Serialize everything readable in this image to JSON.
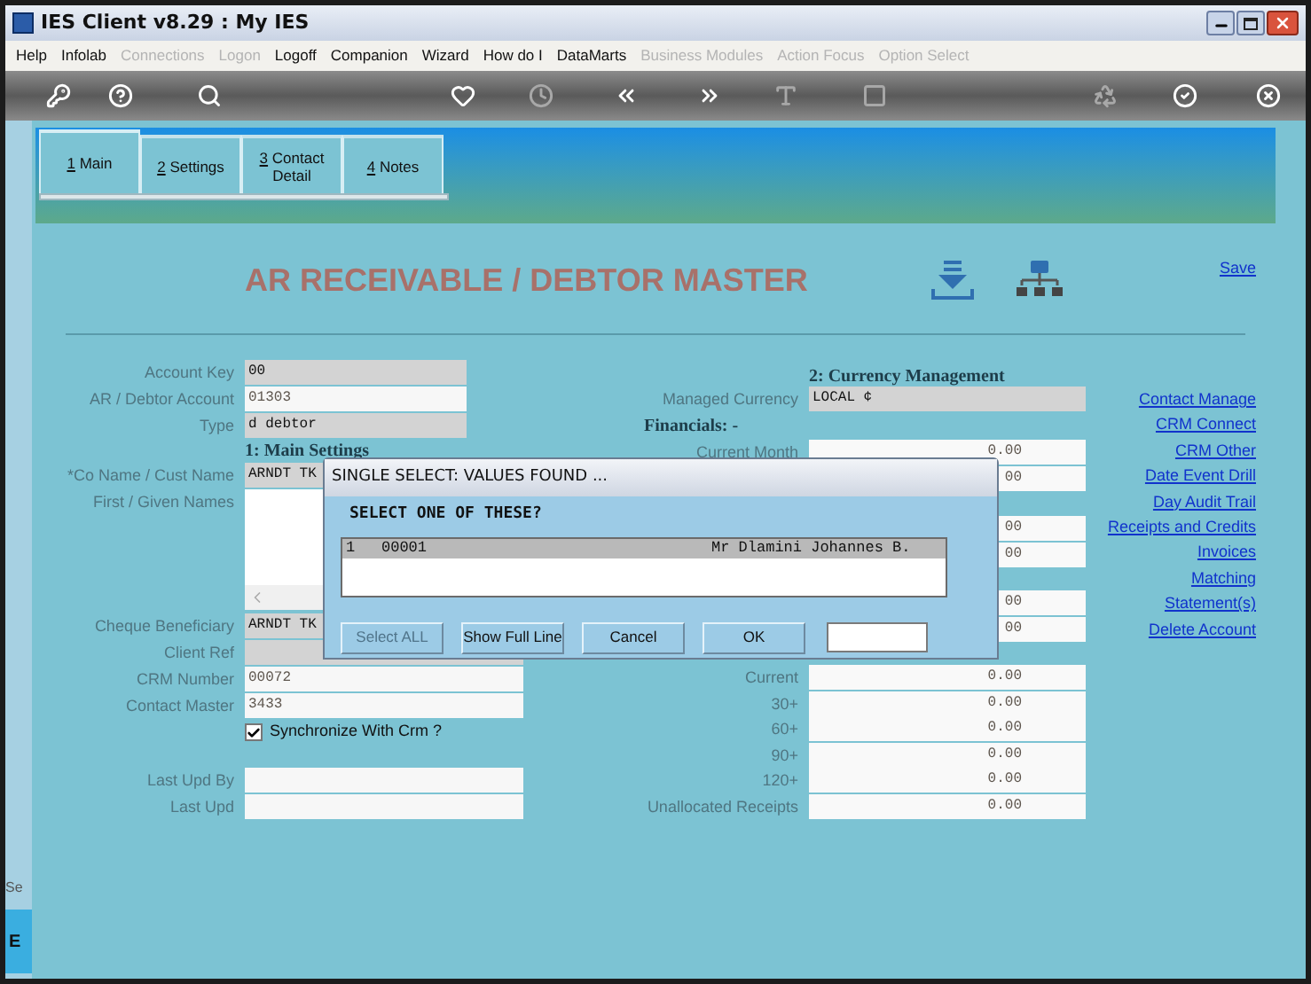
{
  "window": {
    "title": "IES Client v8.29 : My IES"
  },
  "menu": [
    {
      "label": "Help",
      "disabled": false
    },
    {
      "label": "Infolab",
      "disabled": false
    },
    {
      "label": "Connections",
      "disabled": true
    },
    {
      "label": "Logon",
      "disabled": true
    },
    {
      "label": "Logoff",
      "disabled": false
    },
    {
      "label": "Companion",
      "disabled": false
    },
    {
      "label": "Wizard",
      "disabled": false
    },
    {
      "label": "How do I",
      "disabled": false
    },
    {
      "label": "DataMarts",
      "disabled": false
    },
    {
      "label": "Business Modules",
      "disabled": true
    },
    {
      "label": "Action Focus",
      "disabled": true
    },
    {
      "label": "Option Select",
      "disabled": true
    }
  ],
  "toolbar": [
    {
      "kind": "key",
      "disabled": false
    },
    {
      "kind": "help",
      "disabled": false
    },
    {
      "kind": "search",
      "disabled": false
    },
    {
      "kind": "heart",
      "disabled": false
    },
    {
      "kind": "clock",
      "disabled": true
    },
    {
      "kind": "back",
      "disabled": false
    },
    {
      "kind": "forward",
      "disabled": false
    },
    {
      "kind": "text",
      "disabled": true
    },
    {
      "kind": "stop",
      "disabled": true
    },
    {
      "kind": "recycle",
      "disabled": true
    },
    {
      "kind": "check",
      "disabled": false
    },
    {
      "kind": "close",
      "disabled": false
    }
  ],
  "tabs": [
    {
      "mnemonic": "1",
      "label": " Main",
      "selected": true
    },
    {
      "mnemonic": "2",
      "label": " Settings",
      "selected": false
    },
    {
      "mnemonic": "3",
      "label": " Contact Detail",
      "selected": false
    },
    {
      "mnemonic": "4",
      "label": " Notes",
      "selected": false
    }
  ],
  "header": {
    "title": "AR RECEIVABLE / DEBTOR MASTER",
    "save": "Save"
  },
  "left_sections": [
    [
      {
        "kind": "field",
        "label": "Account Key",
        "value": "00",
        "shaded": true
      },
      {
        "kind": "field",
        "label": "AR / Debtor Account",
        "value": "01303",
        "shaded": false
      },
      {
        "kind": "field",
        "label": "Type",
        "value": "d debtor",
        "shaded": true
      },
      {
        "kind": "heading",
        "label": "1: Main Settings"
      },
      {
        "kind": "field",
        "label": "*Co Name / Cust Name",
        "value": "ARNDT TK",
        "shaded": true
      },
      {
        "kind": "memo",
        "label": "First / Given Names"
      }
    ],
    [
      {
        "kind": "field",
        "label": "Cheque Beneficiary",
        "value": "ARNDT TK",
        "shaded": true
      },
      {
        "kind": "field",
        "label": "Client Ref",
        "shaded": true
      },
      {
        "kind": "field",
        "label": "CRM Number",
        "value": "00072",
        "shaded": false
      },
      {
        "kind": "field",
        "label": "Contact Master",
        "value": "3433",
        "shaded": false
      },
      {
        "kind": "checkbox",
        "label": "Synchronize With Crm ?",
        "checked": true
      }
    ],
    [
      {
        "kind": "field",
        "label": "Last Upd By",
        "shaded": false
      },
      {
        "kind": "field",
        "label": "Last Upd",
        "shaded": false
      }
    ]
  ],
  "middle_sections": [
    [
      {
        "kind": "heading",
        "label": "2: Currency Management"
      },
      {
        "kind": "field",
        "label": "Managed Currency",
        "value": "LOCAL ¢",
        "shaded": true
      },
      {
        "kind": "group_heading",
        "label": "Financials: -"
      },
      {
        "kind": "amount",
        "label": "Current Month",
        "value": "0.00"
      },
      {
        "kind": "amount",
        "value": "00"
      }
    ],
    [
      {
        "kind": "amount",
        "value": "00"
      },
      {
        "kind": "amount",
        "value": "00"
      }
    ],
    [
      {
        "kind": "amount",
        "value": "00"
      },
      {
        "kind": "amount",
        "value": "00"
      }
    ],
    [
      {
        "kind": "amount",
        "label": "Current",
        "value": "0.00"
      },
      {
        "kind": "amount",
        "label": "30+",
        "value": "0.00"
      },
      {
        "kind": "amount",
        "label": "60+",
        "value": "0.00"
      },
      {
        "kind": "amount",
        "label": "90+",
        "value": "0.00"
      },
      {
        "kind": "amount",
        "label": "120+",
        "value": "0.00"
      },
      {
        "kind": "amount",
        "label": "Unallocated Receipts",
        "value": "0.00"
      }
    ]
  ],
  "links": [
    "Contact Manage",
    "CRM Connect",
    "CRM Other",
    "Date Event Drill",
    "Day Audit Trail",
    "Receipts and Credits",
    "Invoices",
    "Matching",
    "Statement(s)",
    "Delete Account"
  ],
  "side": {
    "label": "Se",
    "tab": "E"
  },
  "dialog": {
    "title": "SINGLE SELECT: VALUES FOUND ...",
    "prompt": "SELECT ONE OF THESE?",
    "rows": [
      {
        "cells": [
          "1",
          "00001",
          "Mr Dlamini Johannes B."
        ],
        "selected": true
      }
    ],
    "buttons": [
      {
        "label": "Select ALL",
        "disabled": true
      },
      {
        "label": "Show Full Line",
        "disabled": false
      },
      {
        "label": "Cancel",
        "disabled": false
      },
      {
        "label": "OK",
        "disabled": false
      }
    ]
  }
}
